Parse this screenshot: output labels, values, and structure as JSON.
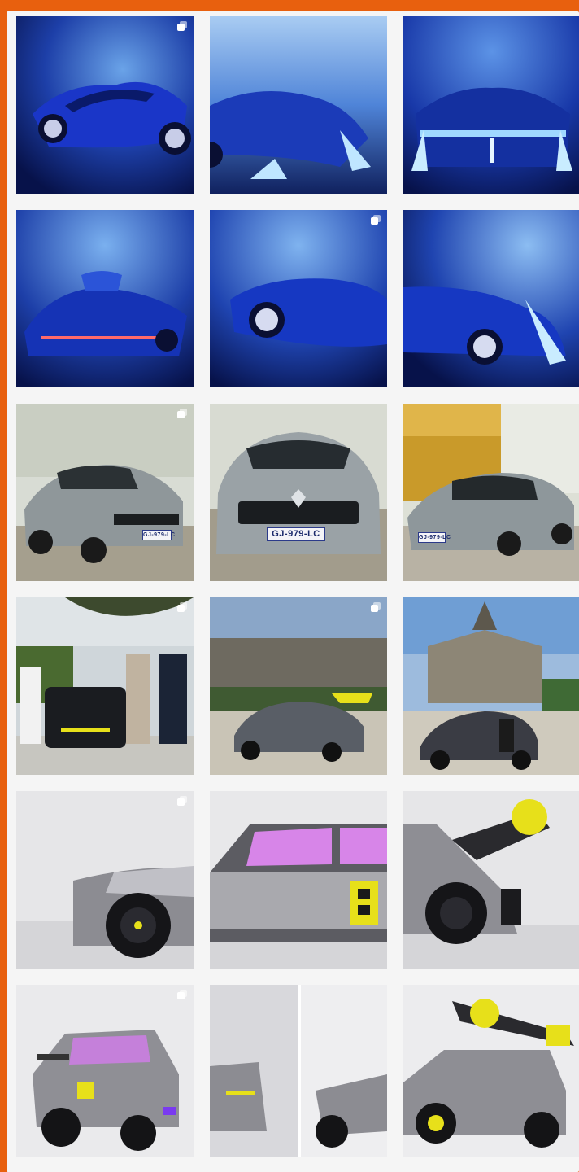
{
  "feed": {
    "posts": [
      {
        "label": "Blue concept hypercar, front three-quarter view",
        "multi": true,
        "theme": "blue-car-side"
      },
      {
        "label": "Blue concept hypercar, rear quarter glow",
        "multi": false,
        "theme": "blue-car-rear-left"
      },
      {
        "label": "Blue concept hypercar, rear lights",
        "multi": false,
        "theme": "blue-car-back"
      },
      {
        "label": "Blue concept hypercar, front view",
        "multi": false,
        "theme": "blue-car-front"
      },
      {
        "label": "Blue concept hypercar, side profile",
        "multi": true,
        "theme": "blue-car-side2"
      },
      {
        "label": "Blue concept hypercar, side profile rear",
        "multi": false,
        "theme": "blue-car-side3"
      },
      {
        "label": "Grey SUV in courtyard, three-quarter",
        "multi": true,
        "theme": "suv-left"
      },
      {
        "label": "Grey SUV front view",
        "multi": false,
        "theme": "suv-front",
        "plate": "GJ-979-LC"
      },
      {
        "label": "Grey SUV with autumn trees",
        "multi": false,
        "theme": "suv-right"
      },
      {
        "label": "People posing with electric car",
        "multi": true,
        "theme": "people-car"
      },
      {
        "label": "Rally car in front of stands",
        "multi": true,
        "theme": "rally-stands"
      },
      {
        "label": "Rally car in front of chateau",
        "multi": false,
        "theme": "rally-chateau"
      },
      {
        "label": "Rally hot hatch panorama part 1",
        "multi": true,
        "theme": "hatch-p1"
      },
      {
        "label": "Rally hot hatch panorama part 2",
        "multi": false,
        "theme": "hatch-p2"
      },
      {
        "label": "Rally hot hatch panorama part 3",
        "multi": false,
        "theme": "hatch-p3"
      },
      {
        "label": "Rally hot hatch three-quarter studio",
        "multi": true,
        "theme": "hatch-studio"
      },
      {
        "label": "Rally hot hatch split studio",
        "multi": false,
        "theme": "hatch-split"
      },
      {
        "label": "Rally hot hatch rear wing",
        "multi": false,
        "theme": "hatch-wing"
      }
    ],
    "plates": {
      "suv_left": "GJ-979-LC",
      "suv_front": "GJ-979-LC",
      "suv_right": "GJ-979-LC"
    }
  },
  "colors": {
    "frame": "#e8600e",
    "panel": "#f5f5f5",
    "blue_deep": "#0b1e6e",
    "blue_light": "#6aa3e8",
    "accent_yellow": "#e7e01a"
  }
}
